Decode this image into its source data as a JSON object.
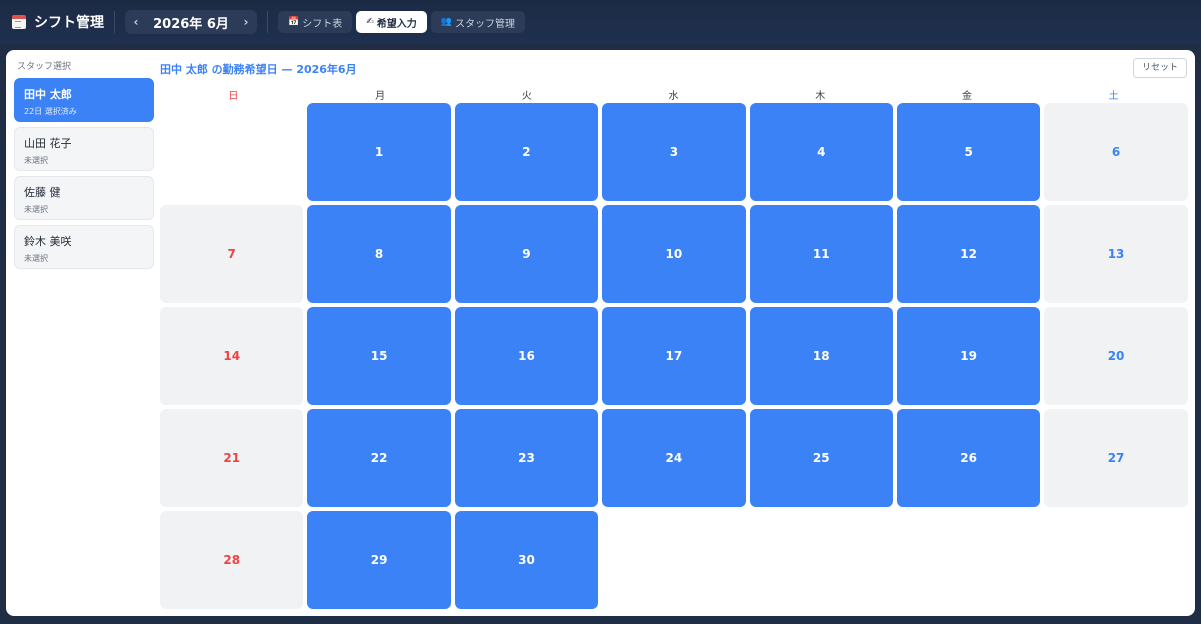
{
  "app": {
    "title": "シフト管理",
    "icon": "calendar-icon"
  },
  "month_nav": {
    "label": "2026年 6月",
    "prev": "‹",
    "next": "›"
  },
  "tabs": [
    {
      "icon": "📅",
      "label": "シフト表",
      "active": false
    },
    {
      "icon": "✍",
      "label": "希望入力",
      "active": true
    },
    {
      "icon": "👥",
      "label": "スタッフ管理",
      "active": false
    }
  ],
  "sidebar": {
    "caption": "スタッフ選択",
    "staff": [
      {
        "name": "田中 太郎",
        "status": "22日 選択済み",
        "active": true
      },
      {
        "name": "山田 花子",
        "status": "未選択",
        "active": false
      },
      {
        "name": "佐藤 健",
        "status": "未選択",
        "active": false
      },
      {
        "name": "鈴木 美咲",
        "status": "未選択",
        "active": false
      }
    ]
  },
  "main": {
    "heading": "田中 太郎 の勤務希望日 — 2026年6月",
    "reset_label": "リセット",
    "weekdays": [
      "日",
      "月",
      "火",
      "水",
      "木",
      "金",
      "土"
    ],
    "first_weekday_index": 1,
    "days_in_month": 30,
    "selected_days": [
      1,
      2,
      3,
      4,
      5,
      8,
      9,
      10,
      11,
      12,
      15,
      16,
      17,
      18,
      19,
      22,
      23,
      24,
      25,
      26,
      29,
      30
    ]
  },
  "colors": {
    "accent": "#3b82f6",
    "sunday": "#ef4444",
    "saturday": "#3b82f6",
    "weekend_bg": "#f1f2f4"
  }
}
